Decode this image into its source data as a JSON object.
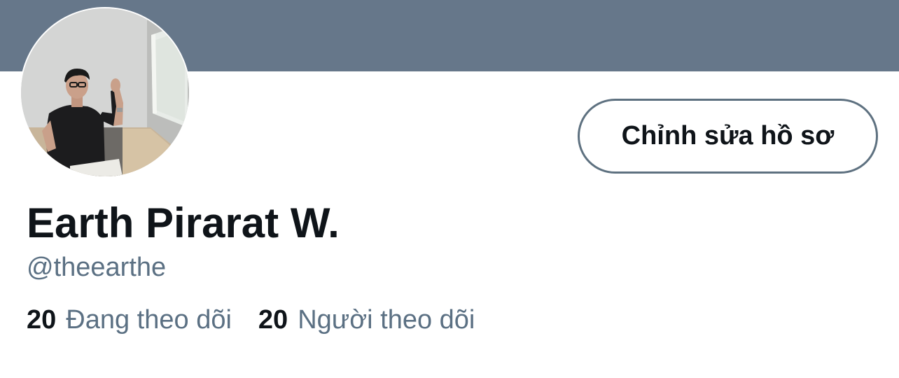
{
  "profile": {
    "display_name": "Earth Pirarat W.",
    "handle": "@theearthe",
    "edit_button_label": "Chỉnh sửa hồ sơ",
    "avatar_alt": "profile photo"
  },
  "stats": {
    "following": {
      "count": "20",
      "label": "Đang theo dõi"
    },
    "followers": {
      "count": "20",
      "label": "Người theo dõi"
    }
  },
  "colors": {
    "banner": "#66778a",
    "text_primary": "#0f1419",
    "text_secondary": "#5b7083",
    "button_border": "#5e7180"
  }
}
